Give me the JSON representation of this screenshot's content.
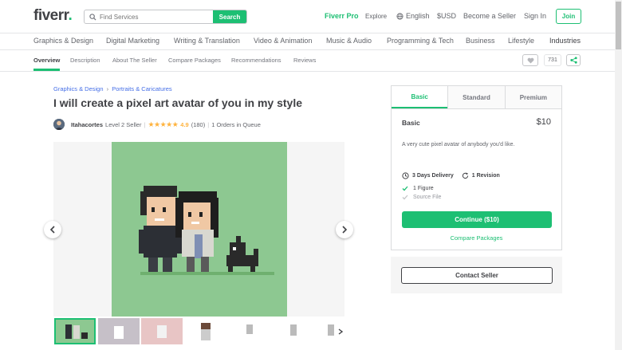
{
  "header": {
    "logo": "fiverr",
    "logo_dot": ".",
    "search_placeholder": "Find Services",
    "search_button": "Search",
    "fiverr_pro": "Fiverr Pro",
    "explore": "Explore",
    "language": "English",
    "currency": "$USD",
    "become_seller": "Become a Seller",
    "sign_in": "Sign In",
    "join": "Join"
  },
  "categories": [
    "Graphics & Design",
    "Digital Marketing",
    "Writing & Translation",
    "Video & Animation",
    "Music & Audio",
    "Programming & Tech",
    "Business",
    "Lifestyle",
    "Industries"
  ],
  "subnav": {
    "items": [
      "Overview",
      "Description",
      "About The Seller",
      "Compare Packages",
      "Recommendations",
      "Reviews"
    ],
    "active": "Overview",
    "like_count": "731"
  },
  "gig": {
    "breadcrumb": [
      "Graphics & Design",
      "Portraits & Caricatures"
    ],
    "breadcrumb_sep": "›",
    "title": "I will create a pixel art avatar of you in my style",
    "seller_name": "Itahacortes",
    "seller_level": "Level 2 Seller",
    "rating": "4.9",
    "reviews": "(180)",
    "orders_in_queue": "1 Orders in Queue"
  },
  "package": {
    "tabs": [
      "Basic",
      "Standard",
      "Premium"
    ],
    "active_tab": "Basic",
    "name": "Basic",
    "price": "$10",
    "description": "A very cute pixel avatar of anybody you'd like.",
    "delivery": "3 Days Delivery",
    "revisions": "1 Revision",
    "features": [
      {
        "label": "1 Figure",
        "included": true
      },
      {
        "label": "Source File",
        "included": false
      }
    ],
    "continue_button": "Continue ($10)",
    "compare_link": "Compare Packages",
    "contact_button": "Contact Seller"
  },
  "colors": {
    "brand_green": "#1dbf73",
    "gallery_bg": "#8dc891",
    "star": "#ffb33e",
    "link_blue": "#446ee7"
  }
}
